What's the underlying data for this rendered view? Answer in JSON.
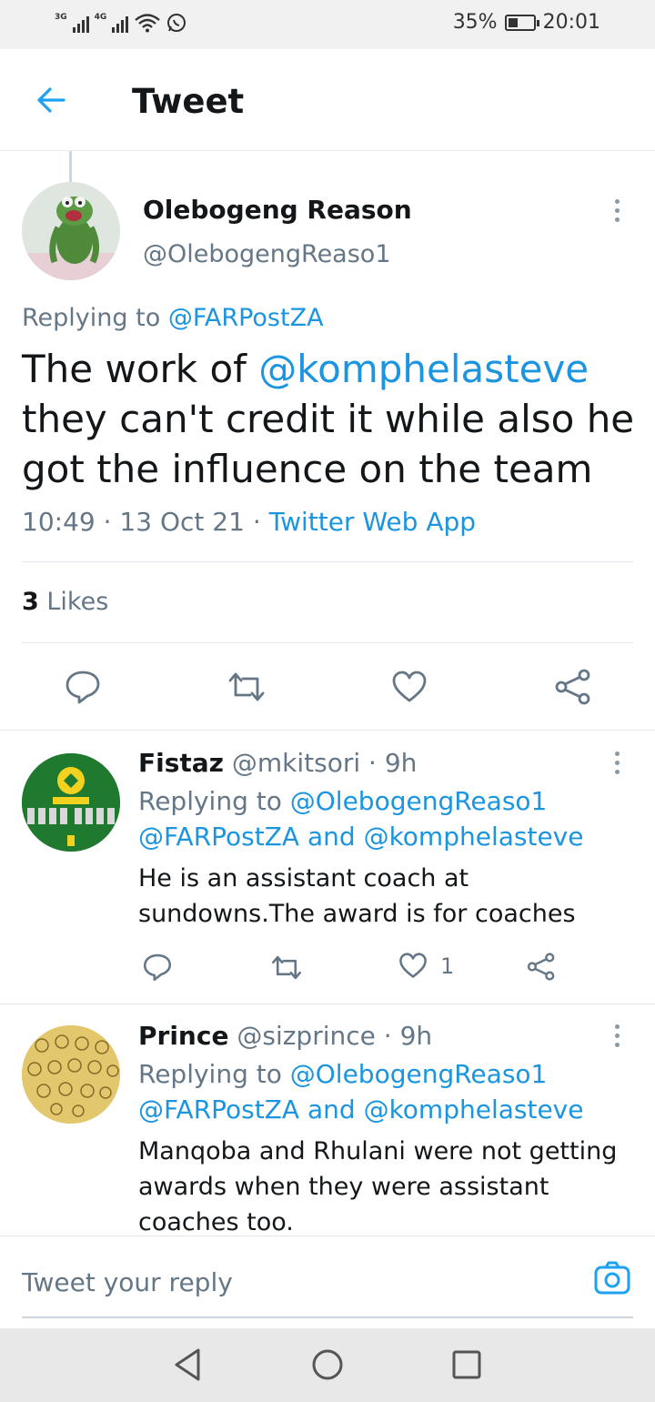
{
  "status_bar": {
    "network_1": "3G",
    "network_2": "4G",
    "battery": "35%",
    "time": "20:01"
  },
  "header": {
    "title": "Tweet"
  },
  "main_tweet": {
    "name": "Olebogeng Reason",
    "handle": "@OlebogengReaso1",
    "replying_prefix": "Replying to",
    "replying_to": "@FARPostZA",
    "text_before": "The work of ",
    "mention": "@komphelasteve",
    "text_after": " they can't credit it while also he got the influence on the team",
    "time": "10:49",
    "date": "13 Oct 21",
    "source": "Twitter Web App",
    "likes_count": "3",
    "likes_label": "Likes"
  },
  "replies": [
    {
      "name": "Fistaz",
      "handle": "@mkitsori",
      "age": "9h",
      "replying_prefix": "Replying to",
      "replying_1": "@OlebogengReaso1",
      "replying_2": "@FARPostZA",
      "and": "and",
      "replying_3": "@komphelasteve",
      "text": "He is an assistant coach at sundowns.The award is for coaches",
      "like_count": "1"
    },
    {
      "name": "Prince",
      "handle": "@sizprince",
      "age": "9h",
      "replying_prefix": "Replying to",
      "replying_1": "@OlebogengReaso1",
      "replying_2": "@FARPostZA",
      "and": "and",
      "replying_3": "@komphelasteve",
      "text": "Manqoba and Rhulani were not getting awards when they were assistant coaches too."
    }
  ],
  "reply_bar": {
    "placeholder": "Tweet your reply"
  },
  "colors": {
    "accent": "#1b95e0",
    "secondary_text": "#657786",
    "primary_text": "#14171a"
  },
  "icons": [
    "back-arrow-icon",
    "more-icon",
    "reply-icon",
    "retweet-icon",
    "like-icon",
    "share-icon",
    "camera-icon",
    "nav-back-icon",
    "nav-home-icon",
    "nav-recents-icon"
  ]
}
